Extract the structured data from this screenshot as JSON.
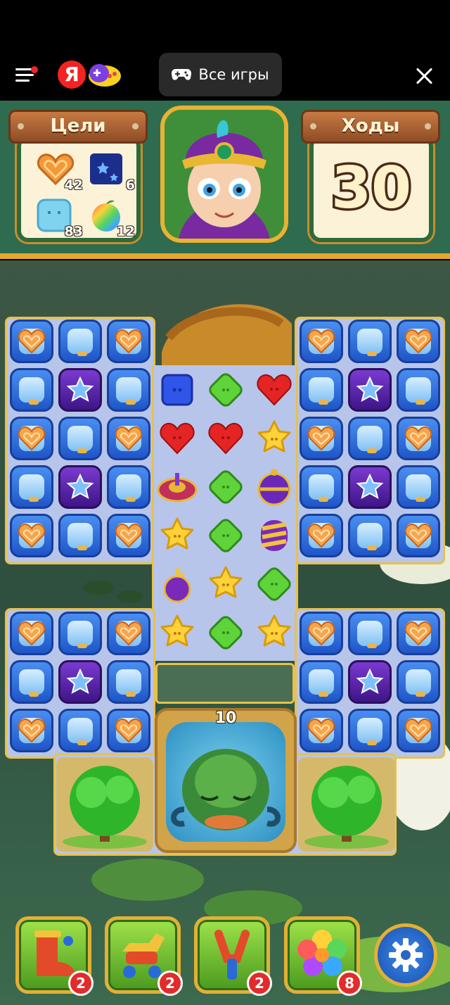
{
  "topbar": {
    "all_games_label": "Все игры",
    "ya_letter": "Я"
  },
  "goals": {
    "title": "Цели",
    "items": [
      {
        "icon": "cookie-heart-icon",
        "count": "42"
      },
      {
        "icon": "star-box-icon",
        "count": "6"
      },
      {
        "icon": "ice-cube-icon",
        "count": "83"
      },
      {
        "icon": "rainbow-apple-icon",
        "count": "12"
      }
    ]
  },
  "moves": {
    "title": "Ходы",
    "value": "30"
  },
  "board": {
    "creature_counter": "10"
  },
  "boosters": [
    {
      "icon": "boot-icon",
      "count": "2"
    },
    {
      "icon": "rocking-horse-icon",
      "count": "2"
    },
    {
      "icon": "slingshot-icon",
      "count": "2"
    },
    {
      "icon": "rainbow-flower-icon",
      "count": "8"
    }
  ],
  "colors": {
    "hud_green": "#2f6b4e",
    "gold_border": "#e6a82a",
    "tile_blue": "#1f55c8",
    "board_bg": "#b8c5ea"
  }
}
